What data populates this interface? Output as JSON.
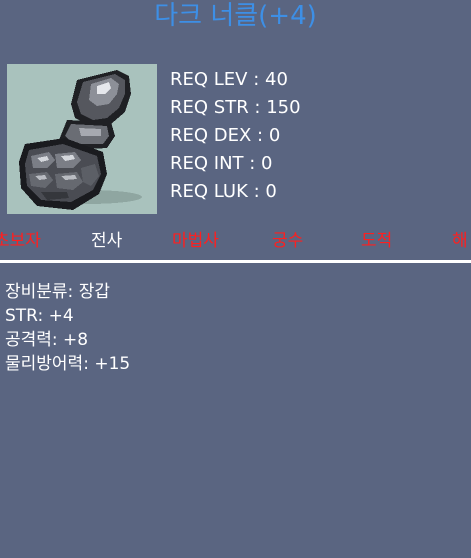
{
  "item": {
    "name": "다크 너클(+4)",
    "icon": "dark-knuckle-glove-icon",
    "requirements": [
      "REQ LEV : 40",
      "REQ STR : 150",
      "REQ DEX : 0",
      "REQ INT : 0",
      "REQ LUK : 0"
    ],
    "jobs": [
      {
        "label": "초보자",
        "allowed": false
      },
      {
        "label": "전사",
        "allowed": true
      },
      {
        "label": "마법사",
        "allowed": false
      },
      {
        "label": "궁수",
        "allowed": false
      },
      {
        "label": "도적",
        "allowed": false
      },
      {
        "label": "해",
        "allowed": false
      }
    ],
    "stats": [
      "장비분류: 장갑",
      "STR: +4",
      "공격력: +8",
      "물리방어력: +15"
    ]
  },
  "colors": {
    "background": "#5a6581",
    "title": "#3d8fe6",
    "allowed_job": "#ffffff",
    "disallowed_job": "#ff1f1f",
    "icon_background": "#a9c2bd"
  }
}
